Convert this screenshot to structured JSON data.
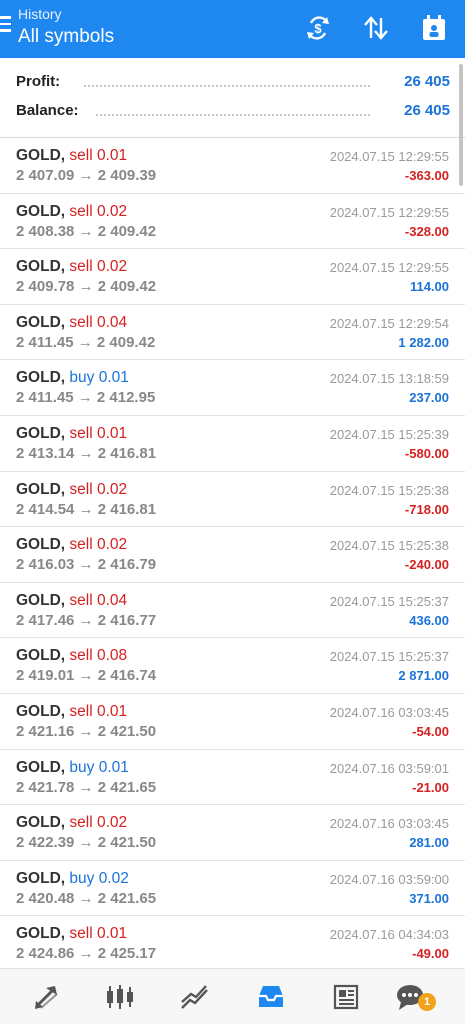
{
  "header": {
    "subtitle": "History",
    "title": "All symbols"
  },
  "summary": {
    "profit_label": "Profit:",
    "profit_value": "26 405",
    "balance_label": "Balance:",
    "balance_value": "26 405"
  },
  "trades": [
    {
      "symbol": "GOLD,",
      "side": "sell",
      "volume": "sell 0.01",
      "prices": "2 407.09 → 2 409.39",
      "time": "2024.07.15 12:29:55",
      "profit": "-363.00",
      "sign": "neg"
    },
    {
      "symbol": "GOLD,",
      "side": "sell",
      "volume": "sell 0.02",
      "prices": "2 408.38 → 2 409.42",
      "time": "2024.07.15 12:29:55",
      "profit": "-328.00",
      "sign": "neg"
    },
    {
      "symbol": "GOLD,",
      "side": "sell",
      "volume": "sell 0.02",
      "prices": "2 409.78 → 2 409.42",
      "time": "2024.07.15 12:29:55",
      "profit": "114.00",
      "sign": "pos"
    },
    {
      "symbol": "GOLD,",
      "side": "sell",
      "volume": "sell 0.04",
      "prices": "2 411.45 → 2 409.42",
      "time": "2024.07.15 12:29:54",
      "profit": "1 282.00",
      "sign": "pos"
    },
    {
      "symbol": "GOLD,",
      "side": "buy",
      "volume": "buy 0.01",
      "prices": "2 411.45 → 2 412.95",
      "time": "2024.07.15 13:18:59",
      "profit": "237.00",
      "sign": "pos"
    },
    {
      "symbol": "GOLD,",
      "side": "sell",
      "volume": "sell 0.01",
      "prices": "2 413.14 → 2 416.81",
      "time": "2024.07.15 15:25:39",
      "profit": "-580.00",
      "sign": "neg"
    },
    {
      "symbol": "GOLD,",
      "side": "sell",
      "volume": "sell 0.02",
      "prices": "2 414.54 → 2 416.81",
      "time": "2024.07.15 15:25:38",
      "profit": "-718.00",
      "sign": "neg"
    },
    {
      "symbol": "GOLD,",
      "side": "sell",
      "volume": "sell 0.02",
      "prices": "2 416.03 → 2 416.79",
      "time": "2024.07.15 15:25:38",
      "profit": "-240.00",
      "sign": "neg"
    },
    {
      "symbol": "GOLD,",
      "side": "sell",
      "volume": "sell 0.04",
      "prices": "2 417.46 → 2 416.77",
      "time": "2024.07.15 15:25:37",
      "profit": "436.00",
      "sign": "pos"
    },
    {
      "symbol": "GOLD,",
      "side": "sell",
      "volume": "sell 0.08",
      "prices": "2 419.01 → 2 416.74",
      "time": "2024.07.15 15:25:37",
      "profit": "2 871.00",
      "sign": "pos"
    },
    {
      "symbol": "GOLD,",
      "side": "sell",
      "volume": "sell 0.01",
      "prices": "2 421.16 → 2 421.50",
      "time": "2024.07.16 03:03:45",
      "profit": "-54.00",
      "sign": "neg"
    },
    {
      "symbol": "GOLD,",
      "side": "buy",
      "volume": "buy 0.01",
      "prices": "2 421.78 → 2 421.65",
      "time": "2024.07.16 03:59:01",
      "profit": "-21.00",
      "sign": "neg"
    },
    {
      "symbol": "GOLD,",
      "side": "sell",
      "volume": "sell 0.02",
      "prices": "2 422.39 → 2 421.50",
      "time": "2024.07.16 03:03:45",
      "profit": "281.00",
      "sign": "pos"
    },
    {
      "symbol": "GOLD,",
      "side": "buy",
      "volume": "buy 0.02",
      "prices": "2 420.48 → 2 421.65",
      "time": "2024.07.16 03:59:00",
      "profit": "371.00",
      "sign": "pos"
    },
    {
      "symbol": "GOLD,",
      "side": "sell",
      "volume": "sell 0.01",
      "prices": "2 424.86 → 2 425.17",
      "time": "2024.07.16 04:34:03",
      "profit": "-49.00",
      "sign": "neg"
    }
  ],
  "colors": {
    "header_bg": "#1e88f0",
    "sell": "#d62020",
    "buy": "#1a73d9",
    "profit_positive": "#1a73d9",
    "profit_negative": "#d62020",
    "badge": "#f3a21b"
  },
  "header_icons": [
    "currency-exchange-icon",
    "sort-icon",
    "calendar-icon"
  ],
  "bottom_nav": {
    "items": [
      "quotes-icon",
      "chart-icon",
      "trade-icon",
      "history-icon",
      "news-icon",
      "chat-icon"
    ],
    "active": "history-icon",
    "chat_badge": "1"
  }
}
